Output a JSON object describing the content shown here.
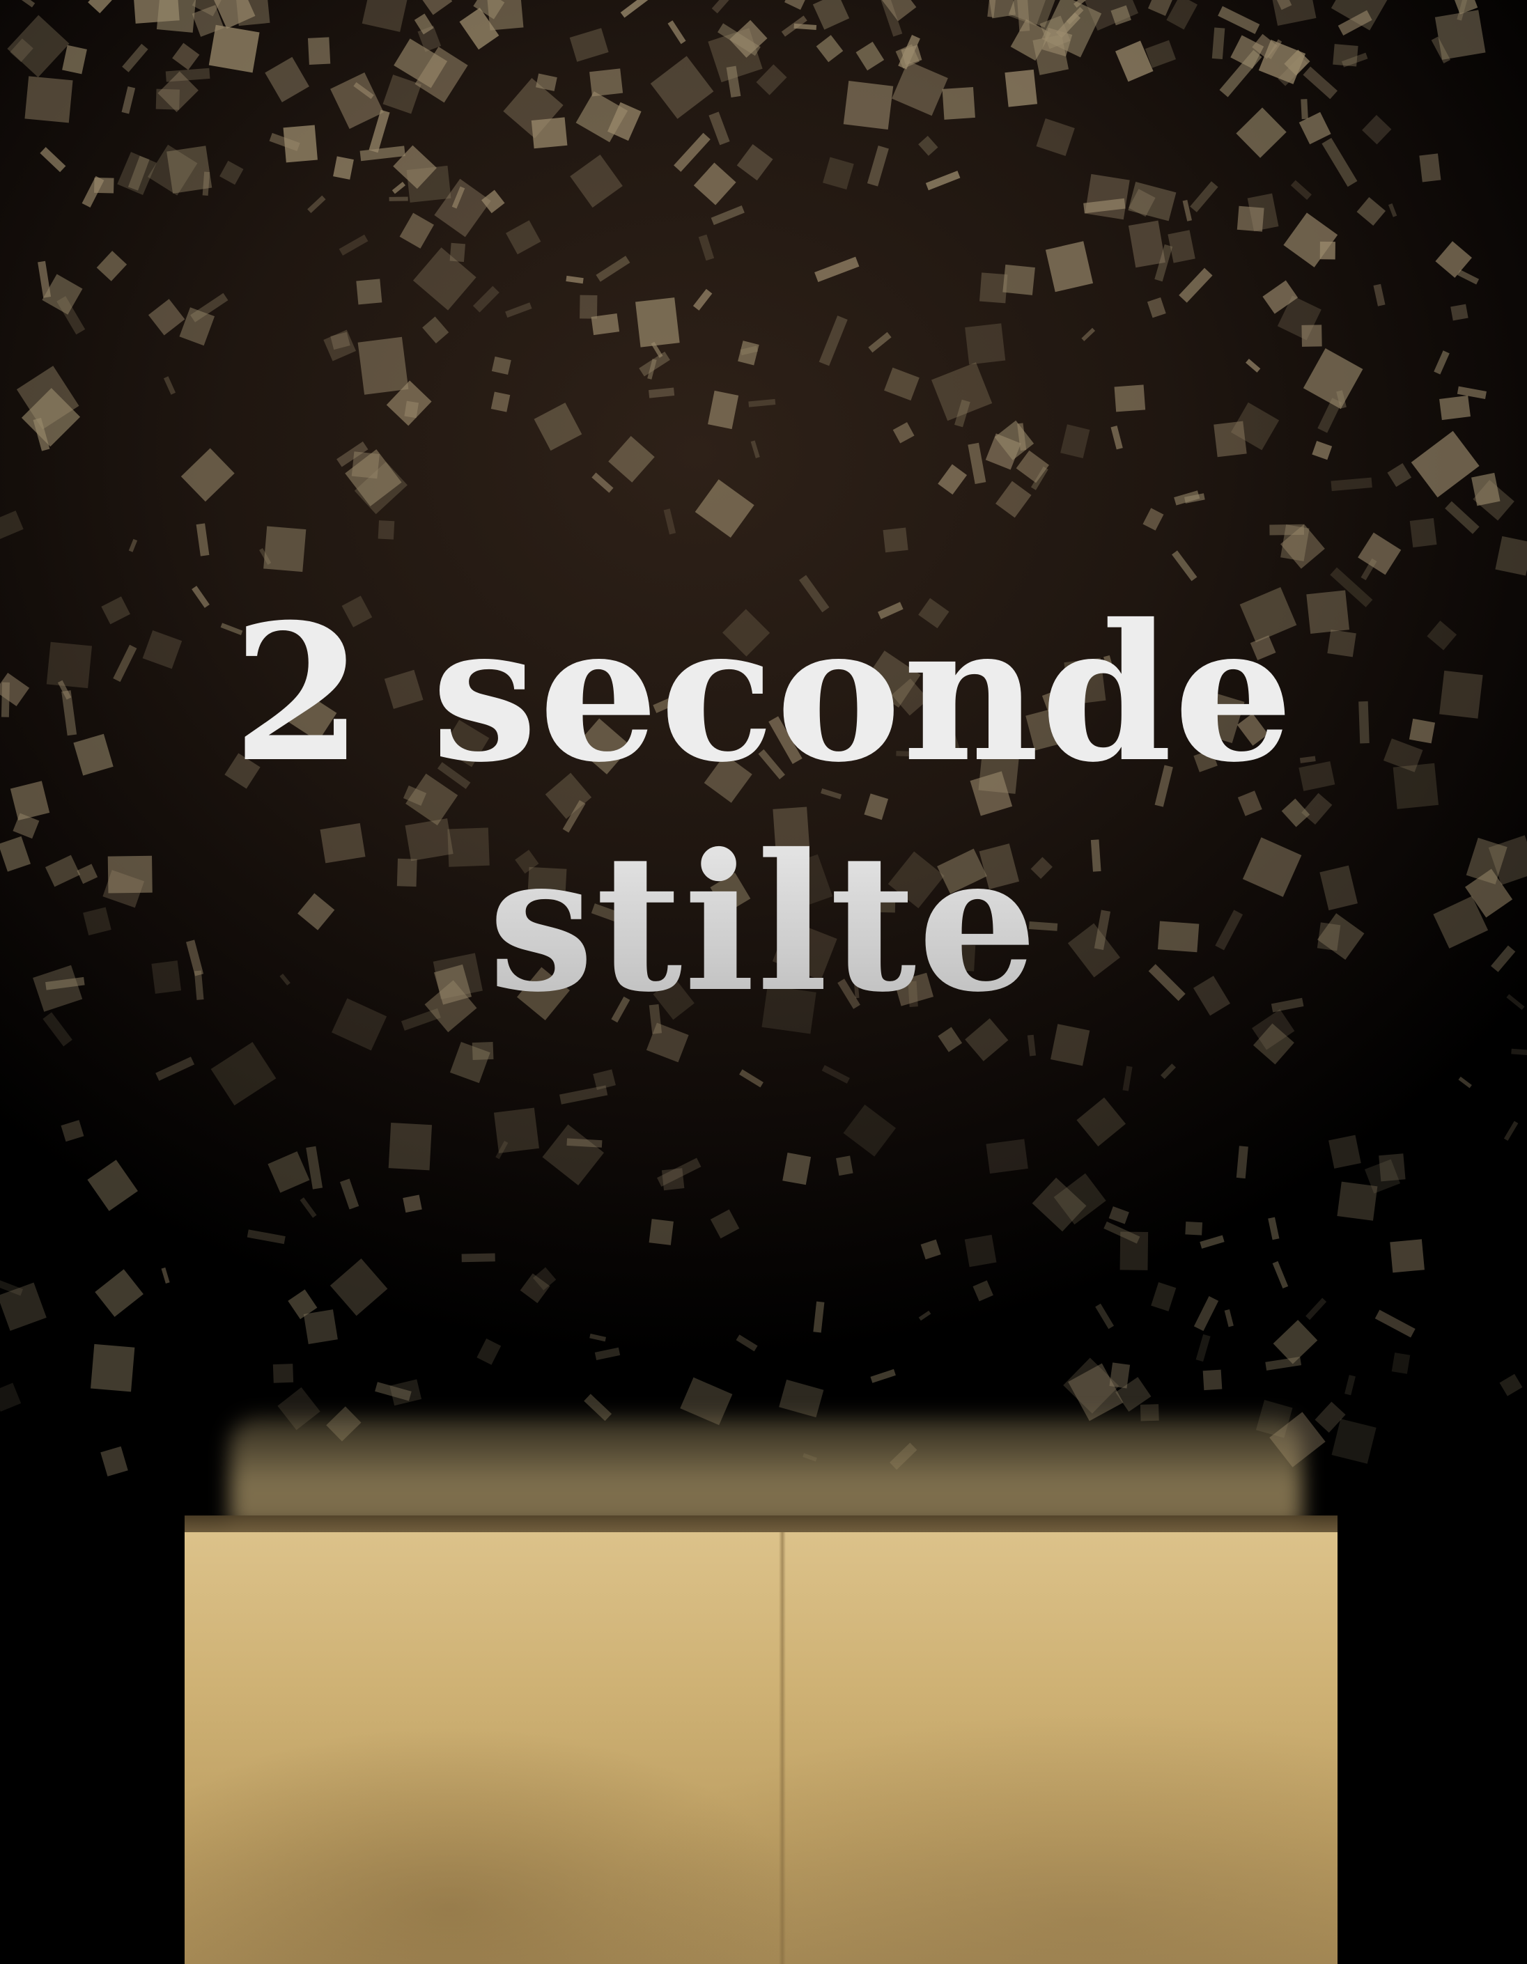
{
  "headline": {
    "line1": "2 seconde",
    "line2": "stilte"
  },
  "colors": {
    "background_dark": "#1f1610",
    "confetti": "#9c8c6e",
    "text": "#ededed",
    "box": "#cfb275"
  },
  "icons": {
    "confetti": "confetti-pieces",
    "box": "gift-box"
  }
}
